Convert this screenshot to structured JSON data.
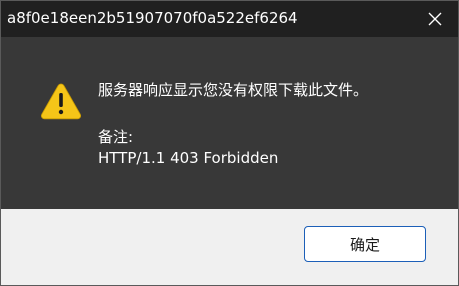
{
  "window": {
    "title": "a8f0e18een2b51907070f0a522ef6264"
  },
  "titlebar": {
    "close_icon": "close-icon"
  },
  "dialog": {
    "icon": "warning-icon",
    "message": "服务器响应显示您没有权限下载此文件。",
    "notes_label": "备注:",
    "notes_text": "HTTP/1.1 403 Forbidden"
  },
  "footer": {
    "ok_label": "确定"
  },
  "colors": {
    "titlebar_bg": "#202020",
    "content_bg": "#383838",
    "footer_bg": "#f0f0f0",
    "warning_yellow": "#f5c518",
    "button_border": "#1c5fb8"
  }
}
